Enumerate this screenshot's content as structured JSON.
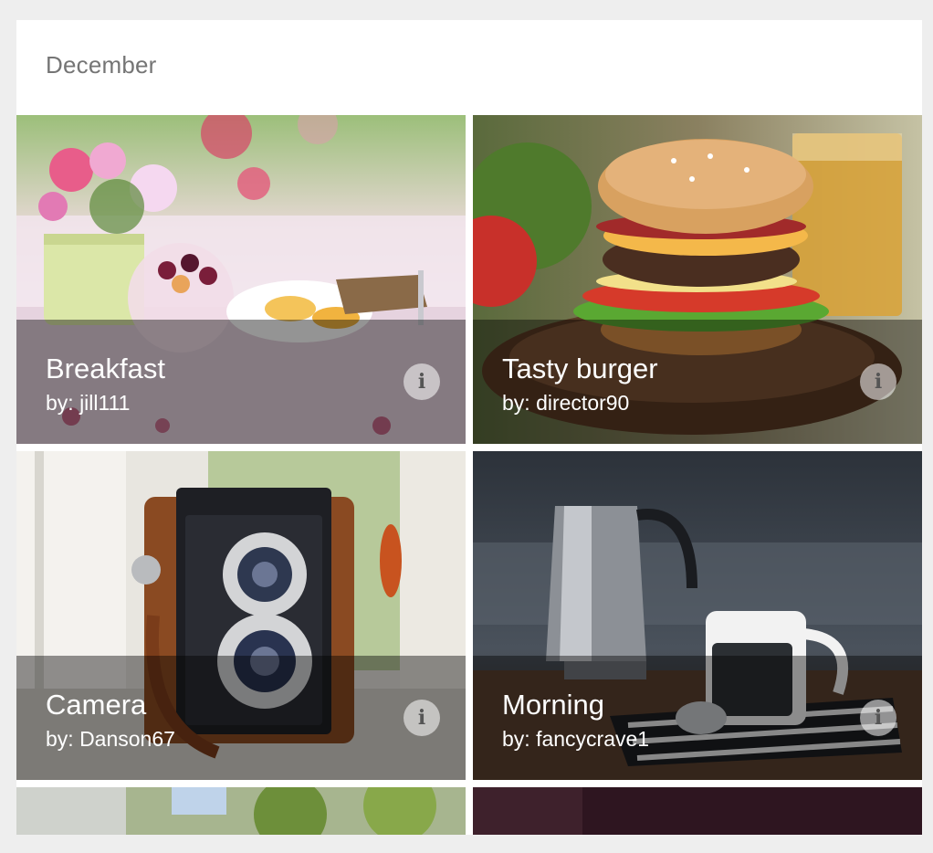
{
  "subheader": {
    "label": "December"
  },
  "tiles": [
    {
      "title": "Breakfast",
      "author": "by: jill111",
      "image": "breakfast-photo",
      "info_icon": "info-icon"
    },
    {
      "title": "Tasty burger",
      "author": "by: director90",
      "image": "burger-photo",
      "info_icon": "info-icon"
    },
    {
      "title": "Camera",
      "author": "by: Danson67",
      "image": "camera-photo",
      "info_icon": "info-icon"
    },
    {
      "title": "Morning",
      "author": "by: fancycrave1",
      "image": "coffee-photo",
      "info_icon": "info-icon"
    }
  ],
  "partial_tiles": [
    {
      "image": "outdoor-trees-photo"
    },
    {
      "image": "dark-purple-photo"
    }
  ],
  "colors": {
    "background": "#eeeeee",
    "panel": "#ffffff",
    "subheader_text": "#757575",
    "titlebar_overlay": "rgba(0,0,0,0.42)"
  }
}
